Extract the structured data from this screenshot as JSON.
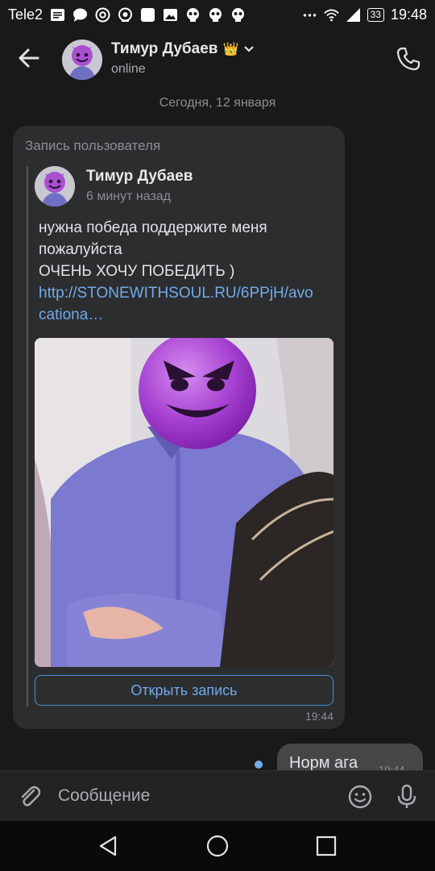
{
  "status_bar": {
    "carrier": "Tele2",
    "battery": "33",
    "time": "19:48"
  },
  "header": {
    "contact_name": "Тимур Дубаев",
    "crown": "👑",
    "status": "online"
  },
  "date_separator": "Сегодня, 12 января",
  "shared_post": {
    "label": "Запись пользователя",
    "author": "Тимур Дубаев",
    "time_ago": "6 минут назад",
    "text_line1": "нужна победа поддержите меня пожалуйста",
    "text_line2": "ОЧЕНЬ ХОЧУ ПОБЕДИТЬ )",
    "link": "http://STONEWITHSOUL.RU/6PPjH/avocationa…",
    "open_button": "Открыть запись",
    "message_time": "19:44"
  },
  "outgoing_message": {
    "text": "Норм ага",
    "time": "19:44"
  },
  "composer": {
    "placeholder": "Сообщение"
  },
  "colors": {
    "accent": "#71aaeb",
    "bubble": "#2c2d2e",
    "background": "#19191a"
  }
}
